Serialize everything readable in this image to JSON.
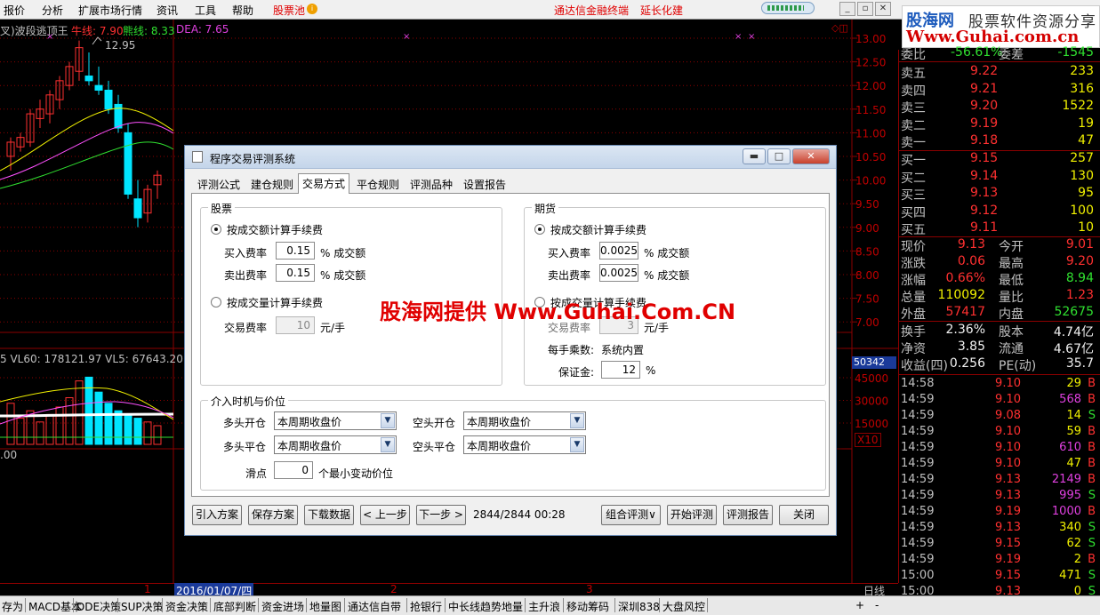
{
  "menubar": {
    "items": [
      "报价",
      "分析",
      "扩展市场行情",
      "资讯",
      "工具",
      "帮助"
    ],
    "stock_pool": "股票池",
    "links": [
      "通达信金融终端",
      "延长化建"
    ],
    "progress_percent": 85
  },
  "logo": {
    "line1_brand": "股海网",
    "line1_text": "股票软件资源分享",
    "line2": "Www.Guhai.com.cn"
  },
  "chart": {
    "indicator_title": "叉)波段逃顶王",
    "niu_label": "牛线: 7.90",
    "xiong_label": "熊线: 8.33",
    "dea_label": "DEA: 7.65",
    "price_peak": "12.95",
    "price_axis": [
      "13.00",
      "12.50",
      "12.00",
      "11.50",
      "11.00",
      "10.50",
      "10.00",
      "9.50",
      "9.00",
      "8.50",
      "8.00",
      "7.50",
      "7.00"
    ],
    "vol_title": "5  VL60: 178121.97  VL5: 67643.20  VL",
    "vol_box": "50342",
    "vol_axis": [
      "45000",
      "30000",
      "15000"
    ],
    "vol_unit": "X10",
    "vol_bottom": ".00",
    "date_label": "2016/01/07/四",
    "page_markers": [
      "1",
      "2",
      "3"
    ],
    "period": "日线",
    "colors": {
      "up": "#ff3030",
      "down": "#00e5ff",
      "grid": "#8b0000",
      "axis_text": "#c00000"
    }
  },
  "quote": {
    "weibi": {
      "label": "委比",
      "value": "-56.61%",
      "label2": "委差",
      "value2": "-1545"
    },
    "asks": [
      {
        "label": "卖五",
        "price": "9.22",
        "vol": "233"
      },
      {
        "label": "卖四",
        "price": "9.21",
        "vol": "316"
      },
      {
        "label": "卖三",
        "price": "9.20",
        "vol": "1522"
      },
      {
        "label": "卖二",
        "price": "9.19",
        "vol": "19"
      },
      {
        "label": "卖一",
        "price": "9.18",
        "vol": "47"
      }
    ],
    "bids": [
      {
        "label": "买一",
        "price": "9.15",
        "vol": "257"
      },
      {
        "label": "买二",
        "price": "9.14",
        "vol": "130"
      },
      {
        "label": "买三",
        "price": "9.13",
        "vol": "95"
      },
      {
        "label": "买四",
        "price": "9.12",
        "vol": "100"
      },
      {
        "label": "买五",
        "price": "9.11",
        "vol": "10"
      }
    ],
    "stats": [
      {
        "l1": "现价",
        "v1": "9.13",
        "l2": "今开",
        "v2": "9.01"
      },
      {
        "l1": "涨跌",
        "v1": "0.06",
        "l2": "最高",
        "v2": "9.20"
      },
      {
        "l1": "涨幅",
        "v1": "0.66%",
        "l2": "最低",
        "v2": "8.94"
      },
      {
        "l1": "总量",
        "v1": "110092",
        "l2": "量比",
        "v2": "1.23"
      },
      {
        "l1": "外盘",
        "v1": "57417",
        "l2": "内盘",
        "v2": "52675"
      }
    ],
    "stats2": [
      {
        "l1": "换手",
        "v1": "2.36%",
        "l2": "股本",
        "v2": "4.74亿"
      },
      {
        "l1": "净资",
        "v1": "3.85",
        "l2": "流通",
        "v2": "4.67亿"
      },
      {
        "l1": "收益(四)",
        "v1": "0.256",
        "l2": "PE(动)",
        "v2": "35.7"
      }
    ],
    "ticks": [
      {
        "t": "14:58",
        "p": "9.10",
        "v": "29",
        "d": "B"
      },
      {
        "t": "14:59",
        "p": "9.10",
        "v": "568",
        "d": "B"
      },
      {
        "t": "14:59",
        "p": "9.08",
        "v": "14",
        "d": "S"
      },
      {
        "t": "14:59",
        "p": "9.10",
        "v": "59",
        "d": "B"
      },
      {
        "t": "14:59",
        "p": "9.10",
        "v": "610",
        "d": "B"
      },
      {
        "t": "14:59",
        "p": "9.10",
        "v": "47",
        "d": "B"
      },
      {
        "t": "14:59",
        "p": "9.13",
        "v": "2149",
        "d": "B"
      },
      {
        "t": "14:59",
        "p": "9.13",
        "v": "995",
        "d": "S"
      },
      {
        "t": "14:59",
        "p": "9.19",
        "v": "1000",
        "d": "B"
      },
      {
        "t": "14:59",
        "p": "9.13",
        "v": "340",
        "d": "S"
      },
      {
        "t": "14:59",
        "p": "9.15",
        "v": "62",
        "d": "S"
      },
      {
        "t": "14:59",
        "p": "9.19",
        "v": "2",
        "d": "B"
      },
      {
        "t": "15:00",
        "p": "9.15",
        "v": "471",
        "d": "S"
      },
      {
        "t": "15:00",
        "p": "9.13",
        "v": "0",
        "d": "S"
      }
    ]
  },
  "dialog": {
    "title": "程序交易评测系统",
    "tabs": [
      "评测公式",
      "建仓规则",
      "交易方式",
      "平仓规则",
      "评测品种",
      "设置报告"
    ],
    "active_tab": "交易方式",
    "stock": {
      "group_title": "股票",
      "radio_amount": "按成交额计算手续费",
      "buy_rate_label": "买入费率",
      "buy_rate": "0.15",
      "sell_rate_label": "卖出费率",
      "sell_rate": "0.15",
      "rate_unit": "% 成交额",
      "radio_volume": "按成交量计算手续费",
      "trade_fee_label": "交易费率",
      "trade_fee": "10",
      "trade_fee_unit": "元/手"
    },
    "futures": {
      "group_title": "期货",
      "radio_amount": "按成交额计算手续费",
      "buy_rate_label": "买入费率",
      "buy_rate": "0.0025",
      "sell_rate_label": "卖出费率",
      "sell_rate": "0.0025",
      "rate_unit": "% 成交额",
      "radio_volume": "按成交量计算手续费",
      "trade_fee_label": "交易费率",
      "trade_fee": "3",
      "trade_fee_unit": "元/手",
      "lot_label": "每手乘数:",
      "lot_value": "系统内置",
      "margin_label": "保证金:",
      "margin_value": "12",
      "margin_unit": "%"
    },
    "entry": {
      "group_title": "介入时机与价位",
      "long_open_label": "多头开仓",
      "long_open": "本周期收盘价",
      "short_open_label": "空头开仓",
      "short_open": "本周期收盘价",
      "long_close_label": "多头平仓",
      "long_close": "本周期收盘价",
      "short_close_label": "空头平仓",
      "short_close": "本周期收盘价",
      "slip_label": "滑点",
      "slip_value": "0",
      "slip_unit": "个最小变动价位"
    },
    "buttons": {
      "import": "引入方案",
      "save": "保存方案",
      "download": "下载数据",
      "prev": "< 上一步",
      "next": "下一步 >",
      "counter": "2844/2844 00:28",
      "combo": "组合评测∨",
      "start": "开始评测",
      "report": "评测报告",
      "close": "关闭"
    }
  },
  "watermark": "股海网提供 Www.Guhai.Com.CN",
  "tabbar": {
    "items": [
      "存为",
      "MACD基本",
      "DDE决策",
      "SUP决策",
      "资金决策",
      "底部判断",
      "资金进场",
      "地量图",
      "通达信自带",
      "抢银行",
      "中长线趋势地量",
      "主升浪",
      "移动筹码",
      "深圳838",
      "大盘风控"
    ],
    "controls": [
      "+",
      "-"
    ]
  }
}
